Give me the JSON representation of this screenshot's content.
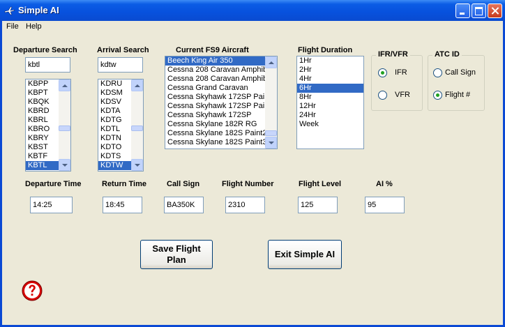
{
  "window": {
    "title": "Simple AI"
  },
  "menu": {
    "file": "File",
    "help": "Help"
  },
  "departure": {
    "label": "Departure Search",
    "search_value": "kbtl",
    "items": [
      "KBPP",
      "KBPT",
      "KBQK",
      "KBRD",
      "KBRL",
      "KBRO",
      "KBRY",
      "KBST",
      "KBTF",
      "KBTL"
    ],
    "selected": "KBTL"
  },
  "arrival": {
    "label": "Arrival Search",
    "search_value": "kdtw",
    "items": [
      "KDRU",
      "KDSM",
      "KDSV",
      "KDTA",
      "KDTG",
      "KDTL",
      "KDTN",
      "KDTO",
      "KDTS",
      "KDTW"
    ],
    "selected": "KDTW"
  },
  "aircraft": {
    "label": "Current FS9 Aircraft",
    "items": [
      "Beech King Air 350",
      "Cessna 208 Caravan Amphib",
      "Cessna 208 Caravan Amphib",
      "Cessna Grand Caravan",
      "Cessna Skyhawk 172SP Pain",
      "Cessna Skyhawk 172SP Pain",
      "Cessna Skyhawk 172SP",
      "Cessna Skylane 182R RG",
      "Cessna Skylane 182S Paint2",
      "Cessna Skylane 182S Paint3"
    ],
    "selected": "Beech King Air 350"
  },
  "duration": {
    "label": "Flight Duration",
    "items": [
      "1Hr",
      "2Hr",
      "4Hr",
      "6Hr",
      "8Hr",
      "12Hr",
      "24Hr",
      "Week"
    ],
    "selected": "6Hr"
  },
  "ifr_vfr": {
    "title": "IFR/VFR",
    "options": [
      {
        "label": "IFR",
        "checked": true
      },
      {
        "label": "VFR",
        "checked": false
      }
    ]
  },
  "atc_id": {
    "title": "ATC ID",
    "options": [
      {
        "label": "Call Sign",
        "checked": false
      },
      {
        "label": "Flight #",
        "checked": true
      }
    ]
  },
  "fields": {
    "departure_time": {
      "label": "Departure Time",
      "value": "14:25"
    },
    "return_time": {
      "label": "Return Time",
      "value": "18:45"
    },
    "call_sign": {
      "label": "Call Sign",
      "value": "BA350K"
    },
    "flight_number": {
      "label": "Flight Number",
      "value": "2310"
    },
    "flight_level": {
      "label": "Flight Level",
      "value": "125"
    },
    "ai_percent": {
      "label": "AI %",
      "value": "95"
    }
  },
  "buttons": {
    "save": "Save Flight Plan",
    "exit": "Exit Simple AI"
  },
  "icons": {
    "app": "airplane-icon",
    "help": "help-icon"
  },
  "colors": {
    "titlebar": "#0a4bd0",
    "selection": "#316ac5",
    "background": "#ece9d8",
    "help_icon": "#d80000"
  }
}
